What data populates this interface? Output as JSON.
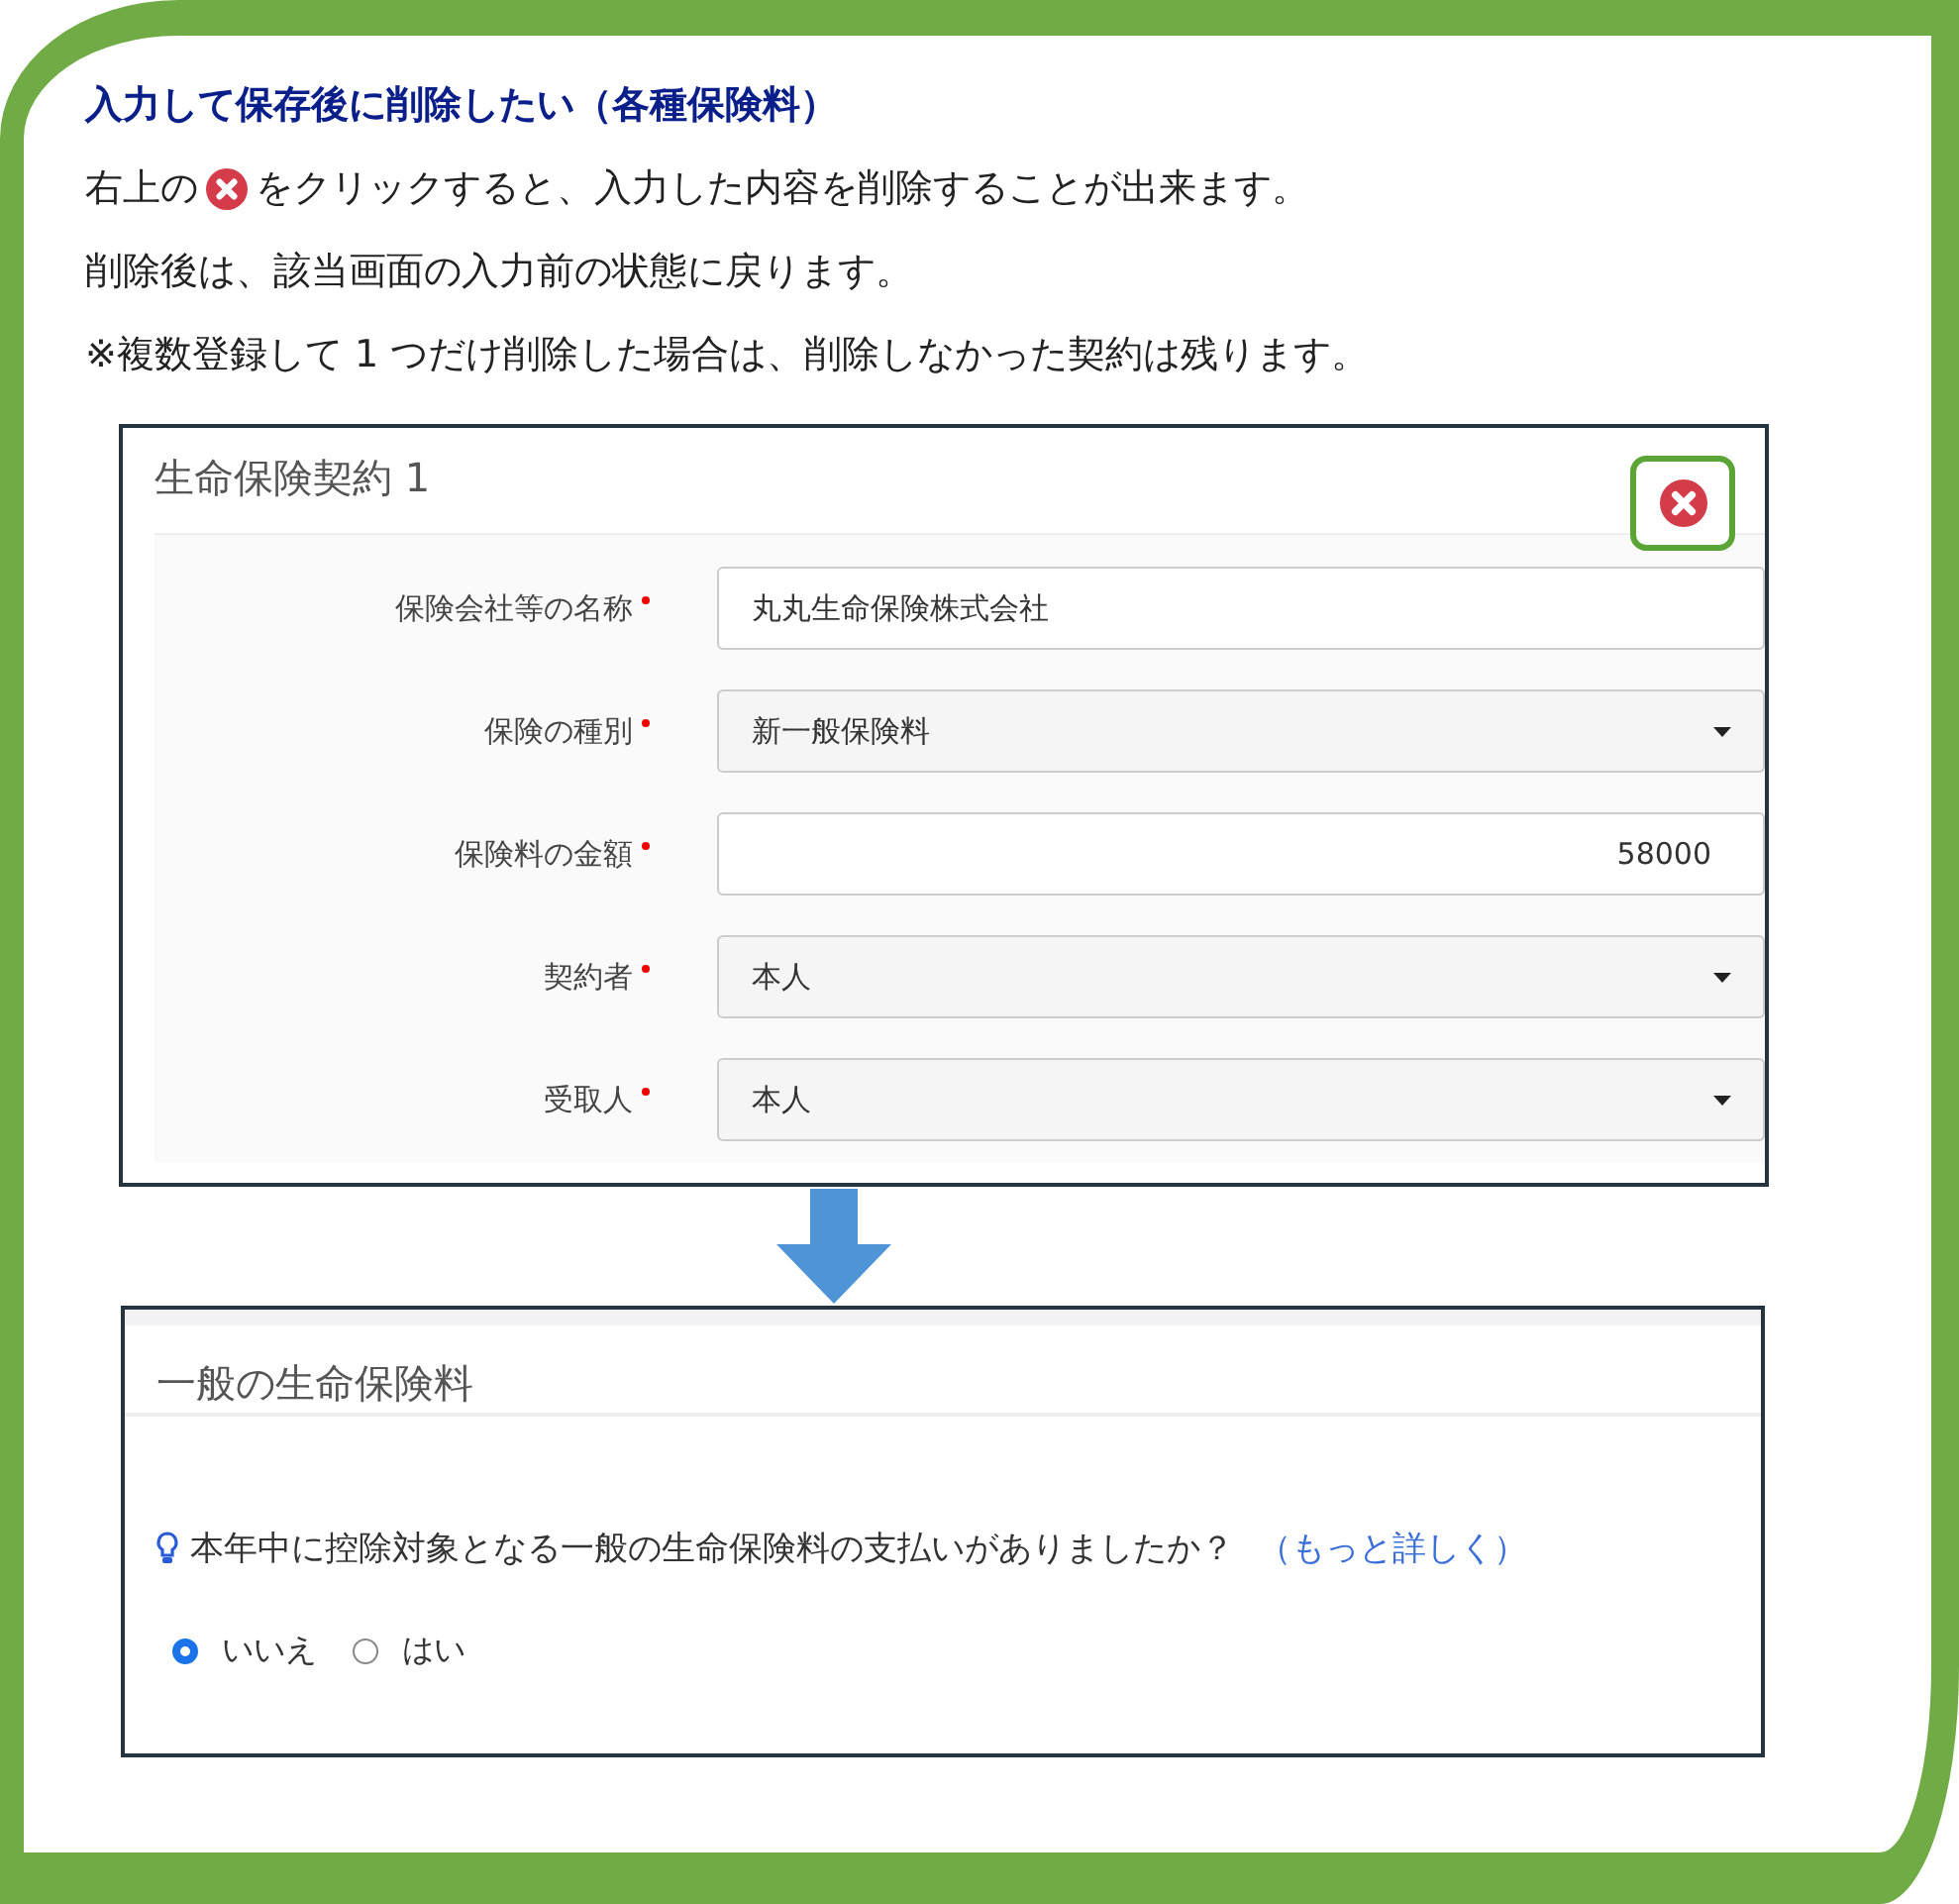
{
  "heading": "入力して保存後に削除したい（各種保険料）",
  "intro": {
    "before": "右上の",
    "after": "をクリックすると、入力した内容を削除することが出来ます。"
  },
  "lines": [
    "削除後は、該当画面の入力前の状態に戻ります。",
    "※複数登録して 1 つだけ削除した場合は、削除しなかった契約は残ります。"
  ],
  "contract_card": {
    "title": "生命保険契約 1",
    "fields": [
      {
        "label": "保険会社等の名称",
        "required": true,
        "kind": "text",
        "value": "丸丸生命保険株式会社"
      },
      {
        "label": "保険の種別",
        "required": true,
        "kind": "select",
        "value": "新一般保険料"
      },
      {
        "label": "保険料の金額",
        "required": true,
        "kind": "number",
        "value": "58000"
      },
      {
        "label": "契約者",
        "required": true,
        "kind": "select",
        "value": "本人"
      },
      {
        "label": "受取人",
        "required": true,
        "kind": "select",
        "value": "本人"
      }
    ]
  },
  "result_card": {
    "title": "一般の生命保険料",
    "question": "本年中に控除対象となる一般の生命保険料の支払いがありましたか？",
    "link": "（もっと詳しく）",
    "options": [
      {
        "label": "いいえ",
        "selected": true
      },
      {
        "label": "はい",
        "selected": false
      }
    ]
  }
}
